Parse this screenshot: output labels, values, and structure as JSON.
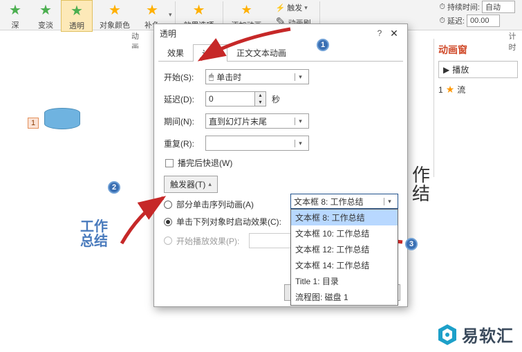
{
  "ribbon": {
    "items": [
      {
        "label": "深"
      },
      {
        "label": "变淡"
      },
      {
        "label": "透明"
      },
      {
        "label": "对象颜色"
      },
      {
        "label": "补色"
      }
    ],
    "effect_options": "效果选项",
    "add_anim": "添加动画",
    "trigger": "触发",
    "anim_brush": "动画刷",
    "duration_label": "持续时间:",
    "duration_value": "自动",
    "delay_label": "延迟:",
    "delay_value": "00.00"
  },
  "rail": {
    "anim": "动画",
    "timing": "计时"
  },
  "dialog": {
    "title": "透明",
    "tabs": {
      "effect": "效果",
      "timing": "计时",
      "text": "正文文本动画"
    },
    "fields": {
      "start_label": "开始(S):",
      "start_value": "单击时",
      "delay_label": "延迟(D):",
      "delay_value": "0",
      "delay_unit": "秒",
      "duration_label": "期间(N):",
      "duration_value": "直到幻灯片末尾",
      "repeat_label": "重复(R):",
      "repeat_value": "",
      "rewind": "播完后快退(W)"
    },
    "trigger_btn": "触发器(T)",
    "radios": {
      "part": "部分单击序列动画(A)",
      "click_obj": "单击下列对象时启动效果(C):",
      "play": "开始播放效果(P):"
    },
    "combo_value": "文本框 8: 工作总结",
    "dropdown": [
      "文本框 8: 工作总结",
      "文本框 10: 工作总结",
      "文本框 12: 工作总结",
      "文本框 14: 工作总结",
      "Title 1: 目录",
      "流程图: 磁盘 1"
    ],
    "ok": "确",
    "cancel": ""
  },
  "slide": {
    "num": "1",
    "text1": "工作",
    "text2": "总结"
  },
  "right": {
    "title": "动画窗",
    "play": "播放",
    "item_num": "1",
    "item_label": "流"
  },
  "behind": {
    "l1": "作",
    "l2": "结"
  },
  "logo": "易软汇",
  "badges": {
    "b1": "1",
    "b2": "2",
    "b3": "3"
  }
}
